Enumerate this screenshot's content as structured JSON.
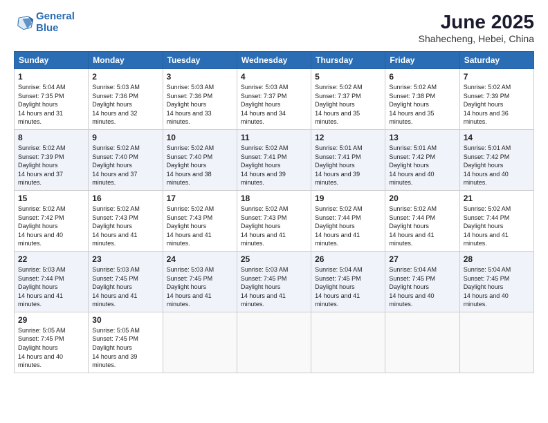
{
  "header": {
    "logo_line1": "General",
    "logo_line2": "Blue",
    "title": "June 2025",
    "subtitle": "Shahecheng, Hebei, China"
  },
  "calendar": {
    "days_of_week": [
      "Sunday",
      "Monday",
      "Tuesday",
      "Wednesday",
      "Thursday",
      "Friday",
      "Saturday"
    ],
    "weeks": [
      [
        null,
        {
          "day": "2",
          "sunrise": "5:03 AM",
          "sunset": "7:36 PM",
          "daylight": "14 hours and 32 minutes."
        },
        {
          "day": "3",
          "sunrise": "5:03 AM",
          "sunset": "7:36 PM",
          "daylight": "14 hours and 33 minutes."
        },
        {
          "day": "4",
          "sunrise": "5:03 AM",
          "sunset": "7:37 PM",
          "daylight": "14 hours and 34 minutes."
        },
        {
          "day": "5",
          "sunrise": "5:02 AM",
          "sunset": "7:37 PM",
          "daylight": "14 hours and 35 minutes."
        },
        {
          "day": "6",
          "sunrise": "5:02 AM",
          "sunset": "7:38 PM",
          "daylight": "14 hours and 35 minutes."
        },
        {
          "day": "7",
          "sunrise": "5:02 AM",
          "sunset": "7:39 PM",
          "daylight": "14 hours and 36 minutes."
        }
      ],
      [
        {
          "day": "1",
          "sunrise": "5:04 AM",
          "sunset": "7:35 PM",
          "daylight": "14 hours and 31 minutes."
        },
        null,
        null,
        null,
        null,
        null,
        null
      ],
      [
        {
          "day": "8",
          "sunrise": "5:02 AM",
          "sunset": "7:39 PM",
          "daylight": "14 hours and 37 minutes."
        },
        {
          "day": "9",
          "sunrise": "5:02 AM",
          "sunset": "7:40 PM",
          "daylight": "14 hours and 37 minutes."
        },
        {
          "day": "10",
          "sunrise": "5:02 AM",
          "sunset": "7:40 PM",
          "daylight": "14 hours and 38 minutes."
        },
        {
          "day": "11",
          "sunrise": "5:02 AM",
          "sunset": "7:41 PM",
          "daylight": "14 hours and 39 minutes."
        },
        {
          "day": "12",
          "sunrise": "5:01 AM",
          "sunset": "7:41 PM",
          "daylight": "14 hours and 39 minutes."
        },
        {
          "day": "13",
          "sunrise": "5:01 AM",
          "sunset": "7:42 PM",
          "daylight": "14 hours and 40 minutes."
        },
        {
          "day": "14",
          "sunrise": "5:01 AM",
          "sunset": "7:42 PM",
          "daylight": "14 hours and 40 minutes."
        }
      ],
      [
        {
          "day": "15",
          "sunrise": "5:02 AM",
          "sunset": "7:42 PM",
          "daylight": "14 hours and 40 minutes."
        },
        {
          "day": "16",
          "sunrise": "5:02 AM",
          "sunset": "7:43 PM",
          "daylight": "14 hours and 41 minutes."
        },
        {
          "day": "17",
          "sunrise": "5:02 AM",
          "sunset": "7:43 PM",
          "daylight": "14 hours and 41 minutes."
        },
        {
          "day": "18",
          "sunrise": "5:02 AM",
          "sunset": "7:43 PM",
          "daylight": "14 hours and 41 minutes."
        },
        {
          "day": "19",
          "sunrise": "5:02 AM",
          "sunset": "7:44 PM",
          "daylight": "14 hours and 41 minutes."
        },
        {
          "day": "20",
          "sunrise": "5:02 AM",
          "sunset": "7:44 PM",
          "daylight": "14 hours and 41 minutes."
        },
        {
          "day": "21",
          "sunrise": "5:02 AM",
          "sunset": "7:44 PM",
          "daylight": "14 hours and 41 minutes."
        }
      ],
      [
        {
          "day": "22",
          "sunrise": "5:03 AM",
          "sunset": "7:44 PM",
          "daylight": "14 hours and 41 minutes."
        },
        {
          "day": "23",
          "sunrise": "5:03 AM",
          "sunset": "7:45 PM",
          "daylight": "14 hours and 41 minutes."
        },
        {
          "day": "24",
          "sunrise": "5:03 AM",
          "sunset": "7:45 PM",
          "daylight": "14 hours and 41 minutes."
        },
        {
          "day": "25",
          "sunrise": "5:03 AM",
          "sunset": "7:45 PM",
          "daylight": "14 hours and 41 minutes."
        },
        {
          "day": "26",
          "sunrise": "5:04 AM",
          "sunset": "7:45 PM",
          "daylight": "14 hours and 41 minutes."
        },
        {
          "day": "27",
          "sunrise": "5:04 AM",
          "sunset": "7:45 PM",
          "daylight": "14 hours and 40 minutes."
        },
        {
          "day": "28",
          "sunrise": "5:04 AM",
          "sunset": "7:45 PM",
          "daylight": "14 hours and 40 minutes."
        }
      ],
      [
        {
          "day": "29",
          "sunrise": "5:05 AM",
          "sunset": "7:45 PM",
          "daylight": "14 hours and 40 minutes."
        },
        {
          "day": "30",
          "sunrise": "5:05 AM",
          "sunset": "7:45 PM",
          "daylight": "14 hours and 39 minutes."
        },
        null,
        null,
        null,
        null,
        null
      ]
    ]
  }
}
